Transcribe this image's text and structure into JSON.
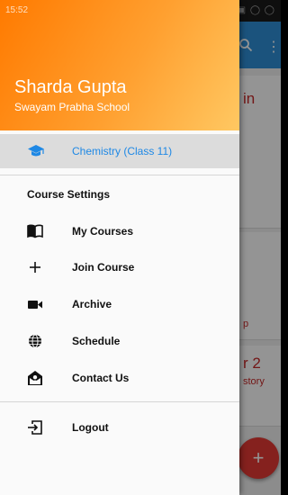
{
  "status_bar": {
    "time": "15:52",
    "icons": "... ◌ ▲ ▣ ◯ ◯"
  },
  "background": {
    "fragment_top": "in",
    "fragment_mid": "p",
    "fragment_big": "r 2",
    "fragment_history": "story",
    "fab_label": "+"
  },
  "drawer": {
    "user_name": "Sharda Gupta",
    "school_name": "Swayam Prabha School",
    "current_course": "Chemistry (Class 11)",
    "section_title": "Course Settings",
    "menu": [
      {
        "label": "My Courses",
        "icon": "book-icon"
      },
      {
        "label": "Join Course",
        "icon": "plus-icon"
      },
      {
        "label": "Archive",
        "icon": "video-icon"
      },
      {
        "label": "Schedule",
        "icon": "globe-icon"
      },
      {
        "label": "Contact Us",
        "icon": "contact-mail-icon"
      }
    ],
    "logout_label": "Logout"
  },
  "colors": {
    "accent": "#1e88e5",
    "header_start": "#ff7a00",
    "header_end": "#ffc862",
    "fab": "#e53935"
  }
}
